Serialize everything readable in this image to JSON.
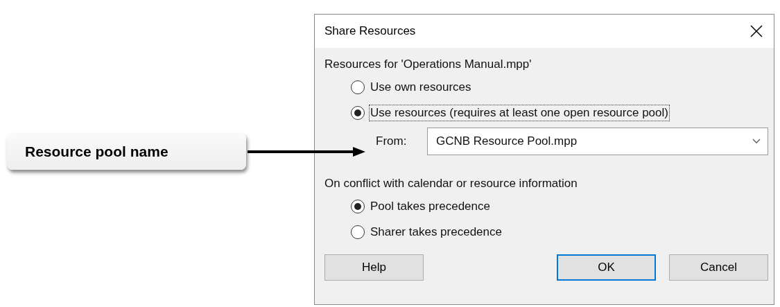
{
  "callout": {
    "text": "Resource pool name"
  },
  "window": {
    "title": "Share Resources"
  },
  "resources_group": {
    "label": "Resources for 'Operations Manual.mpp'",
    "options": [
      {
        "label": "Use own resources",
        "selected": false
      },
      {
        "label": "Use resources (requires at least one open resource pool)",
        "selected": true
      }
    ],
    "from": {
      "label": "From:",
      "value": "GCNB Resource Pool.mpp"
    }
  },
  "conflict_group": {
    "label": "On conflict with calendar or resource information",
    "options": [
      {
        "label": "Pool takes precedence",
        "selected": true
      },
      {
        "label": "Sharer takes precedence",
        "selected": false
      }
    ]
  },
  "buttons": [
    {
      "label": "Help",
      "default": false
    },
    {
      "label": "OK",
      "default": true
    },
    {
      "label": "Cancel",
      "default": false
    }
  ]
}
